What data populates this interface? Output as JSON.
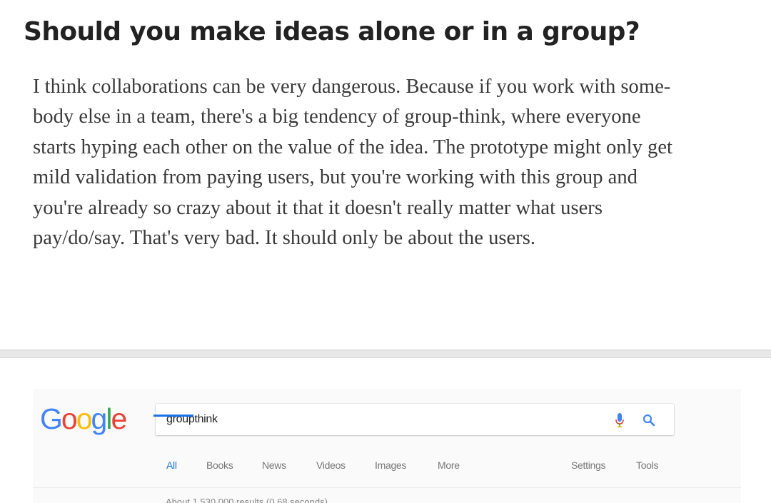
{
  "article": {
    "heading": "Should you make ideas alone or in a group?",
    "paragraph_lines": [
      "I think collaborations can be very dangerous. Because if you work with some-",
      "body else in a team, there's a big tendency of group-think, where everyone",
      "starts hyping each other on the value of the idea. The prototype might only get",
      "mild validation from paying users, but you're working with this group and",
      "you're already so crazy about it that it doesn't really matter what users",
      "pay/do/say. That's very bad. It should only be about the users."
    ]
  },
  "screenshot": {
    "logo": {
      "letters": [
        "G",
        "o",
        "o",
        "g",
        "l",
        "e"
      ],
      "colors": [
        "#4285F4",
        "#EA4335",
        "#FBBC05",
        "#4285F4",
        "#34A853",
        "#EA4335"
      ]
    },
    "search": {
      "query": "groupthink"
    },
    "icons": {
      "mic": "microphone-icon",
      "search": "search-icon"
    },
    "tabs": [
      {
        "label": "All",
        "active": true
      },
      {
        "label": "Books",
        "active": false
      },
      {
        "label": "News",
        "active": false
      },
      {
        "label": "Videos",
        "active": false
      },
      {
        "label": "Images",
        "active": false
      },
      {
        "label": "More",
        "active": false
      },
      {
        "label": "Settings",
        "active": false
      },
      {
        "label": "Tools",
        "active": false
      }
    ],
    "result_stats": "About 1,530,000 results (0.68 seconds)",
    "accent_color": "#1a73e8"
  }
}
